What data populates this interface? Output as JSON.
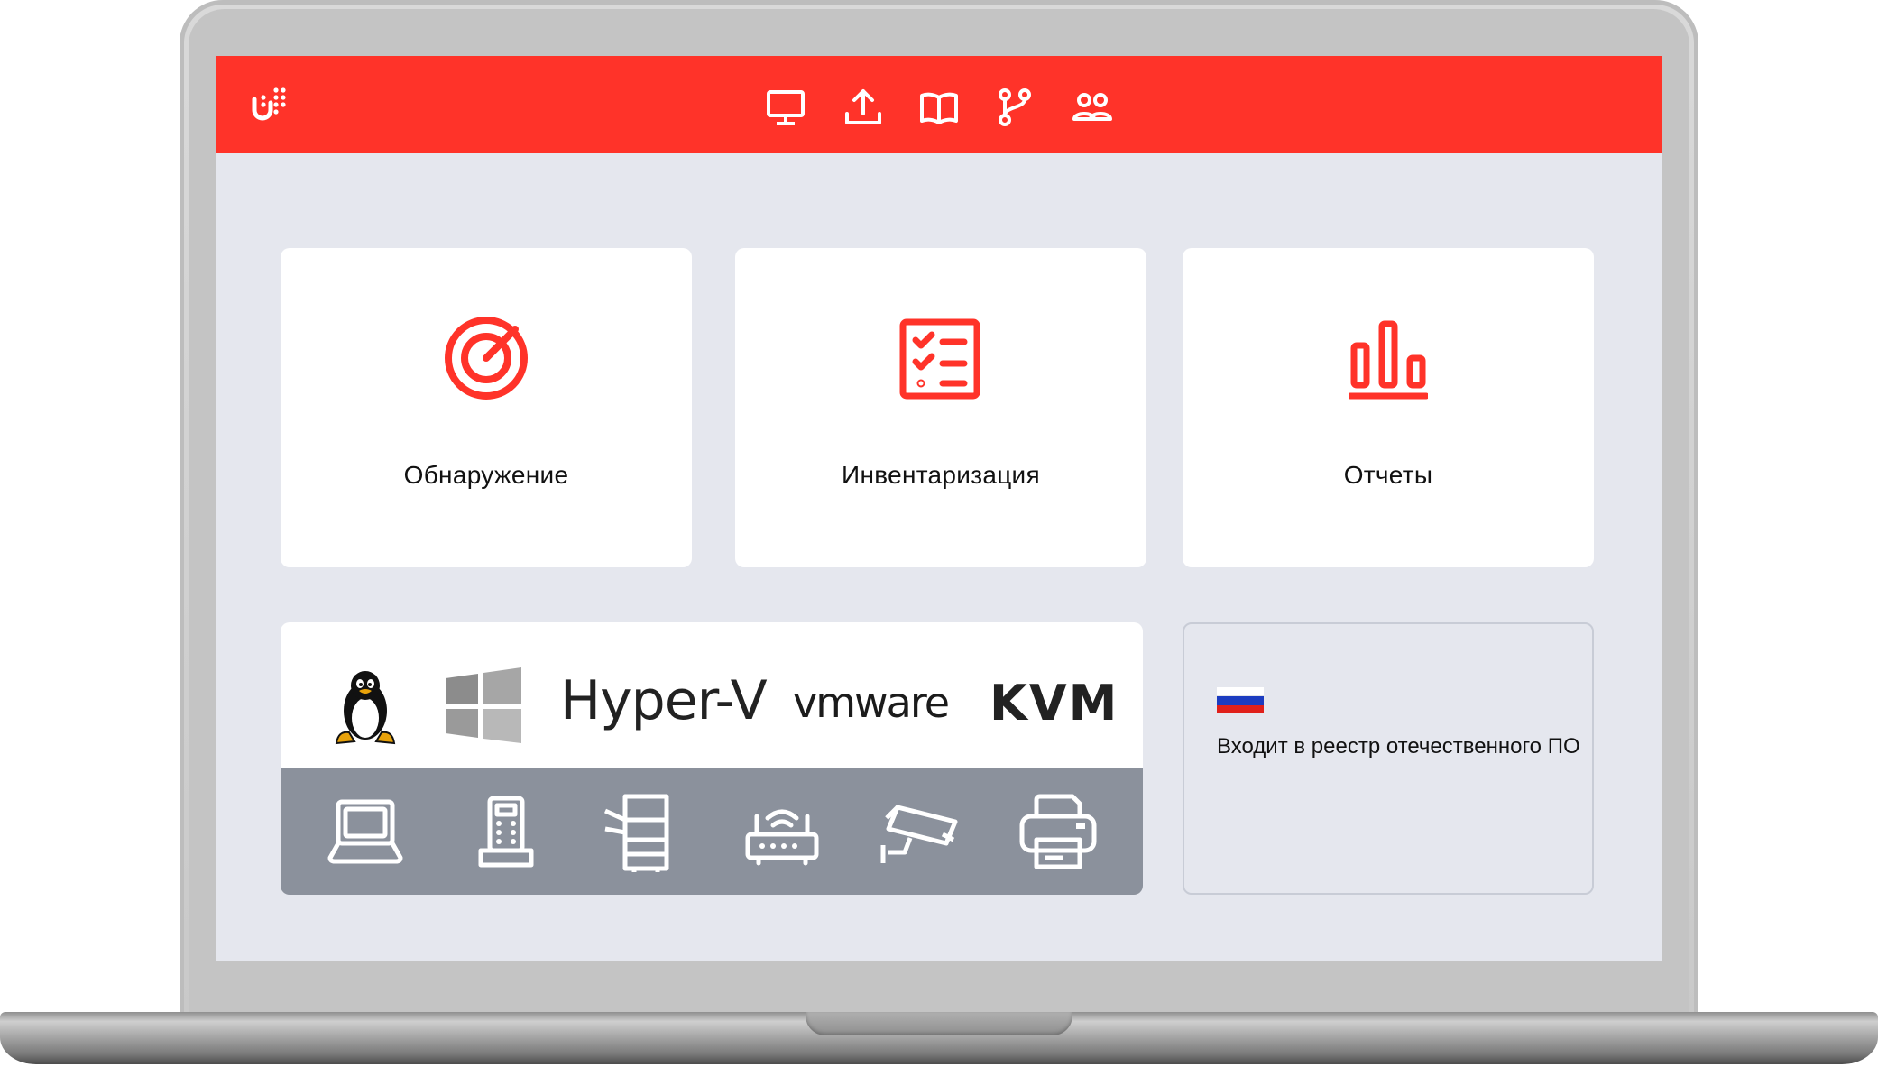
{
  "colors": {
    "accent": "#ff3329",
    "screen_bg": "#e5e7ee",
    "device_strip": "#8b919c"
  },
  "header": {
    "logo": "u-logo-icon",
    "nav": [
      "monitor-icon",
      "upload-icon",
      "book-icon",
      "branch-icon",
      "users-icon"
    ]
  },
  "cards": [
    {
      "label": "Обнаружение",
      "icon": "target-icon"
    },
    {
      "label": "Инвентаризация",
      "icon": "checklist-icon"
    },
    {
      "label": "Отчеты",
      "icon": "bar-chart-icon"
    }
  ],
  "platforms": {
    "items": [
      "linux-tux-icon",
      "windows-logo-icon",
      "Hyper-V",
      "vmware",
      "KVM"
    ],
    "hyperv_text": "Hyper-V",
    "vmware_text": "vmware",
    "kvm_text": "KVM"
  },
  "devices": [
    "laptop-icon",
    "phone-icon",
    "copier-icon",
    "router-icon",
    "camera-icon",
    "printer-icon"
  ],
  "registry": {
    "flag": "russia-flag-icon",
    "text": "Входит в реестр отечественного ПО"
  }
}
